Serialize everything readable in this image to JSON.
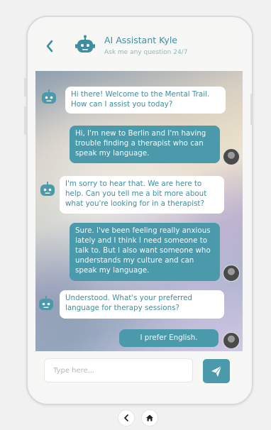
{
  "header": {
    "title": "AI Assistant Kyle",
    "subtitle": "Ask me any question 24/7"
  },
  "messages": [
    {
      "sender": "bot",
      "text": "Hi there! Welcome to the Mental Trail. How can I assist you today?"
    },
    {
      "sender": "user",
      "text": "Hi, I'm new to Berlin and I'm having trouble finding a therapist who can speak my language."
    },
    {
      "sender": "bot",
      "text": "I'm sorry to hear that. We are here to help. Can you tell me a bit more about what you're looking for in a therapist?"
    },
    {
      "sender": "user",
      "text": "Sure. I've been feeling really anxious lately and I think I need someone to talk to. But I also want someone who understands my culture and can speak my language."
    },
    {
      "sender": "bot",
      "text": "Understood. What's your preferred language for therapy sessions?"
    },
    {
      "sender": "user",
      "text": "I prefer English."
    }
  ],
  "composer": {
    "placeholder": "Type here..."
  },
  "icons": {
    "back": "chevron-left-icon",
    "send": "send-icon",
    "nav_back": "chevron-left-icon",
    "nav_home": "home-icon"
  },
  "colors": {
    "accent": "#4a9aab",
    "title": "#3f8ea0"
  }
}
